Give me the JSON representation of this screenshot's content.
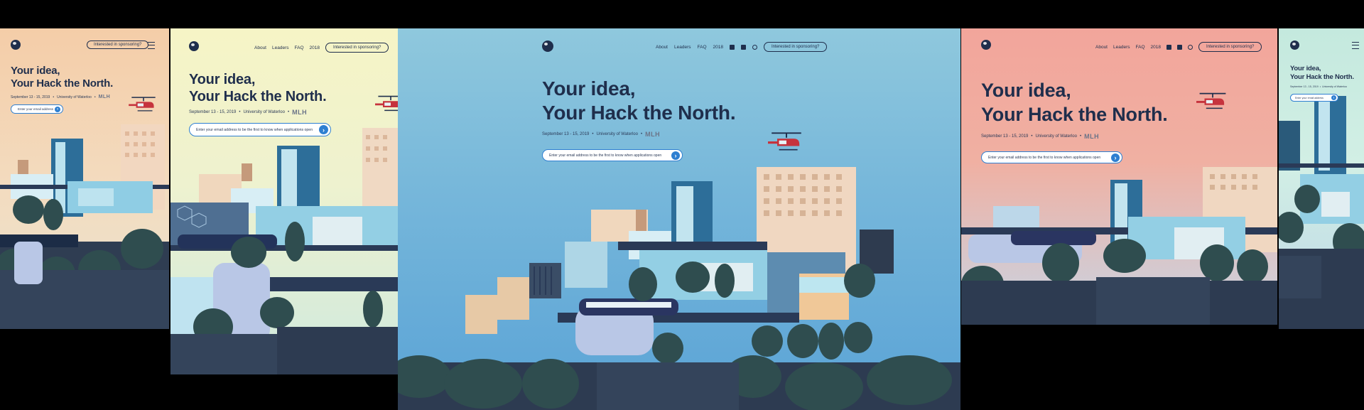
{
  "nav": {
    "about": "About",
    "leaders": "Leaders",
    "faq": "FAQ",
    "year": "2018",
    "sponsor": "Interested in sponsoring?"
  },
  "hero": {
    "line1": "Your idea,",
    "line2": "Your Hack the North.",
    "date": "September 13 - 15, 2019",
    "separator": "•",
    "location": "University of Waterloo",
    "sponsor_logo": "MLH"
  },
  "signup": {
    "placeholder_full": "Enter your email address to be the first to know when applications open",
    "placeholder_short": "Enter your email address"
  },
  "icons": {
    "logo": "globe-logo-icon",
    "menu": "hamburger-menu-icon",
    "submit": "arrow-right-icon",
    "facebook": "facebook-icon",
    "twitter": "twitter-icon",
    "instagram": "instagram-icon",
    "helicopter": "helicopter-icon"
  },
  "colors": {
    "peach_bg": "#f4cda8",
    "cream_bg": "#f5f3c5",
    "blue_bg": "#7dbfdc",
    "pink_bg": "#f1a29a",
    "mint_bg": "#bfe6dd",
    "navy": "#1f2e4c",
    "accent_blue": "#2e7fd1",
    "helicopter_red": "#c6333d"
  }
}
